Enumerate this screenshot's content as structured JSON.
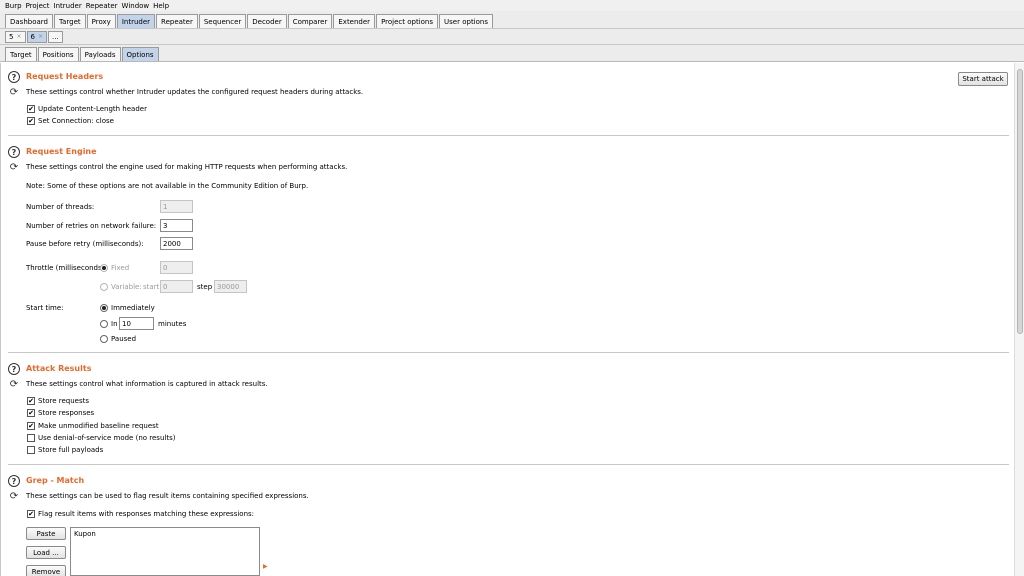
{
  "menu": [
    "Burp",
    "Project",
    "Intruder",
    "Repeater",
    "Window",
    "Help"
  ],
  "main_tabs": [
    "Dashboard",
    "Target",
    "Proxy",
    "Intruder",
    "Repeater",
    "Sequencer",
    "Decoder",
    "Comparer",
    "Extender",
    "Project options",
    "User options"
  ],
  "main_tab_selected": "Intruder",
  "attack_tabs": {
    "tab5": "5",
    "tab6": "6",
    "close": "×",
    "more": "..."
  },
  "sub_tabs": [
    "Target",
    "Positions",
    "Payloads",
    "Options"
  ],
  "sub_tab_selected": "Options",
  "start_attack_label": "Start attack",
  "request_headers": {
    "title": "Request Headers",
    "description": "These settings control whether Intruder updates the configured request headers during attacks.",
    "update_content_length": {
      "label": "Update Content-Length header",
      "checked": true
    },
    "set_connection": {
      "label": "Set Connection: close",
      "checked": true
    }
  },
  "request_engine": {
    "title": "Request Engine",
    "description": "These settings control the engine used for making HTTP requests when performing attacks.",
    "note": "Note: Some of these options are not available in the Community Edition of Burp.",
    "threads_label": "Number of threads:",
    "threads_value": "1",
    "retries_label": "Number of retries on network failure:",
    "retries_value": "3",
    "pause_label": "Pause before retry (milliseconds):",
    "pause_value": "2000",
    "throttle_label": "Throttle (milliseconds):",
    "fixed_label": "Fixed",
    "fixed_value": "0",
    "variable_label": "Variable:",
    "start_label": "start",
    "start_value": "0",
    "step_label": "step",
    "step_value": "30000",
    "start_time_label": "Start time:",
    "immediately_label": "Immediately",
    "in_label": "In",
    "in_value": "10",
    "minutes_label": "minutes",
    "paused_label": "Paused",
    "start_time_selected": "Immediately"
  },
  "attack_results": {
    "title": "Attack Results",
    "description": "These settings control what information is captured in attack results.",
    "store_requests": {
      "label": "Store requests",
      "checked": true
    },
    "store_responses": {
      "label": "Store responses",
      "checked": true
    },
    "make_baseline": {
      "label": "Make unmodified baseline request",
      "checked": true
    },
    "dos_mode": {
      "label": "Use denial-of-service mode (no results)",
      "checked": false
    },
    "store_full_payloads": {
      "label": "Store full payloads",
      "checked": false
    }
  },
  "grep_match": {
    "title": "Grep - Match",
    "description": "These settings can be used to flag result items containing specified expressions.",
    "flag_label": "Flag result items with responses matching these expressions:",
    "flag_checked": true,
    "paste_label": "Paste",
    "load_label": "Load ...",
    "remove_label": "Remove",
    "items": [
      "Kupon"
    ]
  },
  "colors": {
    "heading": "#e8692a",
    "selected_tab": "#c3d4ea"
  }
}
